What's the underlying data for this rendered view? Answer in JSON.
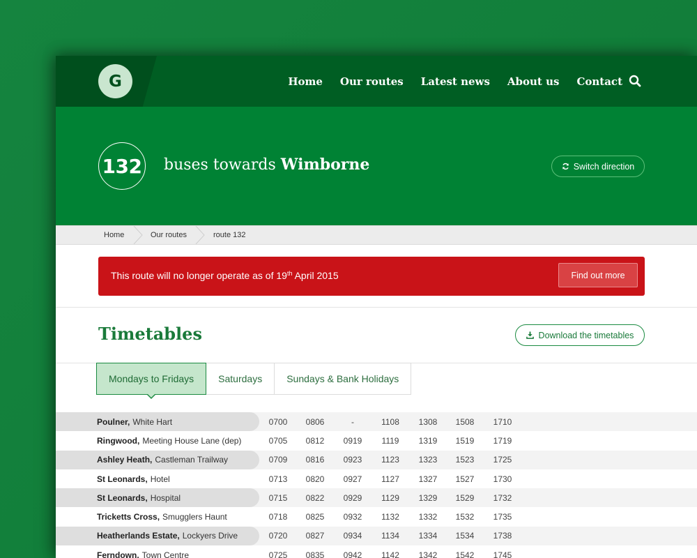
{
  "brand": {
    "logo_letter": "G"
  },
  "nav": {
    "items": [
      "Home",
      "Our routes",
      "Latest news",
      "About us",
      "Contact"
    ]
  },
  "hero": {
    "route_number": "132",
    "title_prefix": "buses towards",
    "destination": "Wimborne",
    "switch_label": "Switch direction"
  },
  "breadcrumb": {
    "items": [
      "Home",
      "Our routes",
      "route 132"
    ]
  },
  "alert": {
    "text_before": "This route will no longer operate as of 19",
    "superscript": "th",
    "text_after": " April 2015",
    "button_label": "Find out more"
  },
  "timetables": {
    "title": "Timetables",
    "download_label": "Download the timetables",
    "tabs": [
      "Mondays to Fridays",
      "Saturdays",
      "Sundays & Bank Holidays"
    ],
    "active_tab": 0
  },
  "timetable_rows": [
    {
      "place": "Poulner,",
      "stop": "White Hart",
      "times": [
        "0700",
        "0806",
        "-",
        "1108",
        "1308",
        "1508",
        "1710"
      ]
    },
    {
      "place": "Ringwood,",
      "stop": "Meeting House Lane (dep)",
      "times": [
        "0705",
        "0812",
        "0919",
        "1119",
        "1319",
        "1519",
        "1719"
      ]
    },
    {
      "place": "Ashley Heath,",
      "stop": "Castleman Trailway",
      "times": [
        "0709",
        "0816",
        "0923",
        "1123",
        "1323",
        "1523",
        "1725"
      ]
    },
    {
      "place": "St Leonards,",
      "stop": "Hotel",
      "times": [
        "0713",
        "0820",
        "0927",
        "1127",
        "1327",
        "1527",
        "1730"
      ]
    },
    {
      "place": "St Leonards,",
      "stop": "Hospital",
      "times": [
        "0715",
        "0822",
        "0929",
        "1129",
        "1329",
        "1529",
        "1732"
      ]
    },
    {
      "place": "Tricketts Cross,",
      "stop": "Smugglers Haunt",
      "times": [
        "0718",
        "0825",
        "0932",
        "1132",
        "1332",
        "1532",
        "1735"
      ]
    },
    {
      "place": "Heatherlands Estate,",
      "stop": "Lockyers Drive",
      "times": [
        "0720",
        "0827",
        "0934",
        "1134",
        "1334",
        "1534",
        "1738"
      ]
    },
    {
      "place": "Ferndown,",
      "stop": "Town Centre",
      "times": [
        "0725",
        "0835",
        "0942",
        "1142",
        "1342",
        "1542",
        "1745"
      ]
    }
  ],
  "colors": {
    "background": "#15843f",
    "nav": "#005e23",
    "hero": "#008234",
    "alert": "#c91318",
    "accent_text": "#1a7a3a",
    "active_tab": "#c5e6cc"
  }
}
